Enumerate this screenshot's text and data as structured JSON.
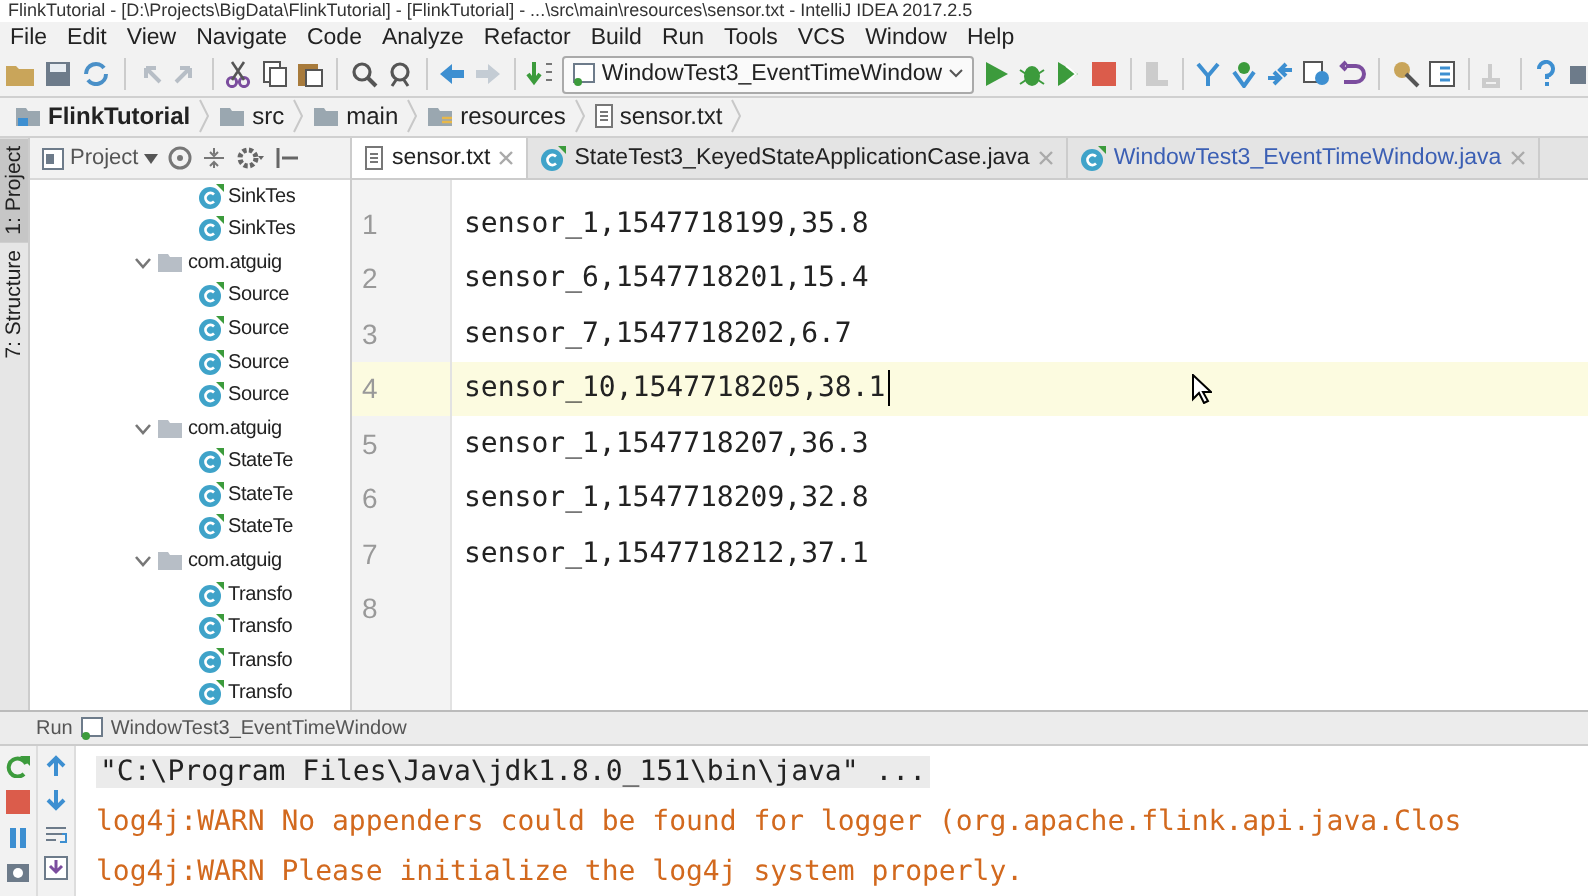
{
  "window": {
    "title": "FlinkTutorial - [D:\\Projects\\BigData\\FlinkTutorial] - [FlinkTutorial] - ...\\src\\main\\resources\\sensor.txt - IntelliJ IDEA 2017.2.5"
  },
  "menu": [
    "File",
    "Edit",
    "View",
    "Navigate",
    "Code",
    "Analyze",
    "Refactor",
    "Build",
    "Run",
    "Tools",
    "VCS",
    "Window",
    "Help"
  ],
  "toolbar": {
    "run_config": "WindowTest3_EventTimeWindow"
  },
  "breadcrumbs": [
    {
      "label": "FlinkTutorial",
      "kind": "project"
    },
    {
      "label": "src",
      "kind": "folder"
    },
    {
      "label": "main",
      "kind": "folder"
    },
    {
      "label": "resources",
      "kind": "resources"
    },
    {
      "label": "sensor.txt",
      "kind": "file"
    }
  ],
  "side_tabs": [
    {
      "label": "1: Project",
      "selected": true
    },
    {
      "label": "7: Structure",
      "selected": false
    }
  ],
  "project_panel": {
    "view": "Project",
    "tree": [
      {
        "label": "SinkTes",
        "kind": "class"
      },
      {
        "label": "SinkTes",
        "kind": "class"
      },
      {
        "label": "com.atguig",
        "kind": "package",
        "expanded": true,
        "children": [
          {
            "label": "Source",
            "kind": "class"
          },
          {
            "label": "Source",
            "kind": "class"
          },
          {
            "label": "Source",
            "kind": "class"
          },
          {
            "label": "Source",
            "kind": "class"
          }
        ]
      },
      {
        "label": "com.atguig",
        "kind": "package",
        "expanded": true,
        "children": [
          {
            "label": "StateTe",
            "kind": "class"
          },
          {
            "label": "StateTe",
            "kind": "class"
          },
          {
            "label": "StateTe",
            "kind": "class"
          }
        ]
      },
      {
        "label": "com.atguig",
        "kind": "package",
        "expanded": true,
        "children": [
          {
            "label": "Transfo",
            "kind": "class"
          },
          {
            "label": "Transfo",
            "kind": "class"
          },
          {
            "label": "Transfo",
            "kind": "class"
          },
          {
            "label": "Transfo",
            "kind": "class"
          }
        ]
      }
    ]
  },
  "editor": {
    "tabs": [
      {
        "label": "sensor.txt",
        "kind": "text",
        "selected": true,
        "modified": false
      },
      {
        "label": "StateTest3_KeyedStateApplicationCase.java",
        "kind": "class",
        "selected": false,
        "modified": false
      },
      {
        "label": "WindowTest3_EventTimeWindow.java",
        "kind": "class",
        "selected": false,
        "modified": true
      }
    ],
    "lines": [
      {
        "number": "1",
        "text": "sensor_1,1547718199,35.8",
        "current": false
      },
      {
        "number": "2",
        "text": "sensor_6,1547718201,15.4",
        "current": false
      },
      {
        "number": "3",
        "text": "sensor_7,1547718202,6.7",
        "current": false
      },
      {
        "number": "4",
        "text": "sensor_10,1547718205,38.1",
        "current": true
      },
      {
        "number": "5",
        "text": "sensor_1,1547718207,36.3",
        "current": false
      },
      {
        "number": "6",
        "text": "sensor_1,1547718209,32.8",
        "current": false
      },
      {
        "number": "7",
        "text": "sensor_1,1547718212,37.1",
        "current": false
      },
      {
        "number": "8",
        "current": false
      }
    ]
  },
  "run_panel": {
    "label": "Run",
    "config": "WindowTest3_EventTimeWindow",
    "console": [
      {
        "kind": "command",
        "text": "\"C:\\Program Files\\Java\\jdk1.8.0_151\\bin\\java\" ..."
      },
      {
        "kind": "warn",
        "text": "log4j:WARN No appenders could be found for logger (org.apache.flink.api.java.Clos"
      },
      {
        "kind": "warn",
        "text": "log4j:WARN Please initialize the log4j system properly."
      }
    ]
  }
}
